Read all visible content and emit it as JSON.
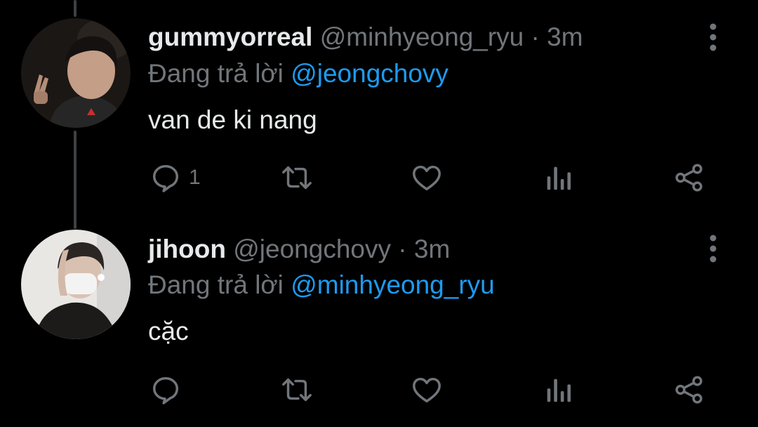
{
  "colors": {
    "background": "#000000",
    "primary_text": "#e7e9ea",
    "secondary_text": "#71767b",
    "link": "#1d9bf0",
    "thread_line": "#3e4144"
  },
  "tweets": [
    {
      "display_name": "gummyorreal",
      "handle": "@minhyeong_ryu",
      "separator": "·",
      "time": "3m",
      "reply_prefix": "Đang trả lời",
      "reply_to": "@jeongchovy",
      "text": "van de ki nang",
      "reply_count": "1",
      "icons": [
        "more-vertical-icon",
        "reply-icon",
        "retweet-icon",
        "like-icon",
        "analytics-icon",
        "share-icon"
      ]
    },
    {
      "display_name": "jihoon",
      "handle": "@jeongchovy",
      "separator": "·",
      "time": "3m",
      "reply_prefix": "Đang trả lời",
      "reply_to": "@minhyeong_ryu",
      "text": "cặc",
      "reply_count": "",
      "icons": [
        "more-vertical-icon",
        "reply-icon",
        "retweet-icon",
        "like-icon",
        "analytics-icon",
        "share-icon"
      ]
    }
  ]
}
